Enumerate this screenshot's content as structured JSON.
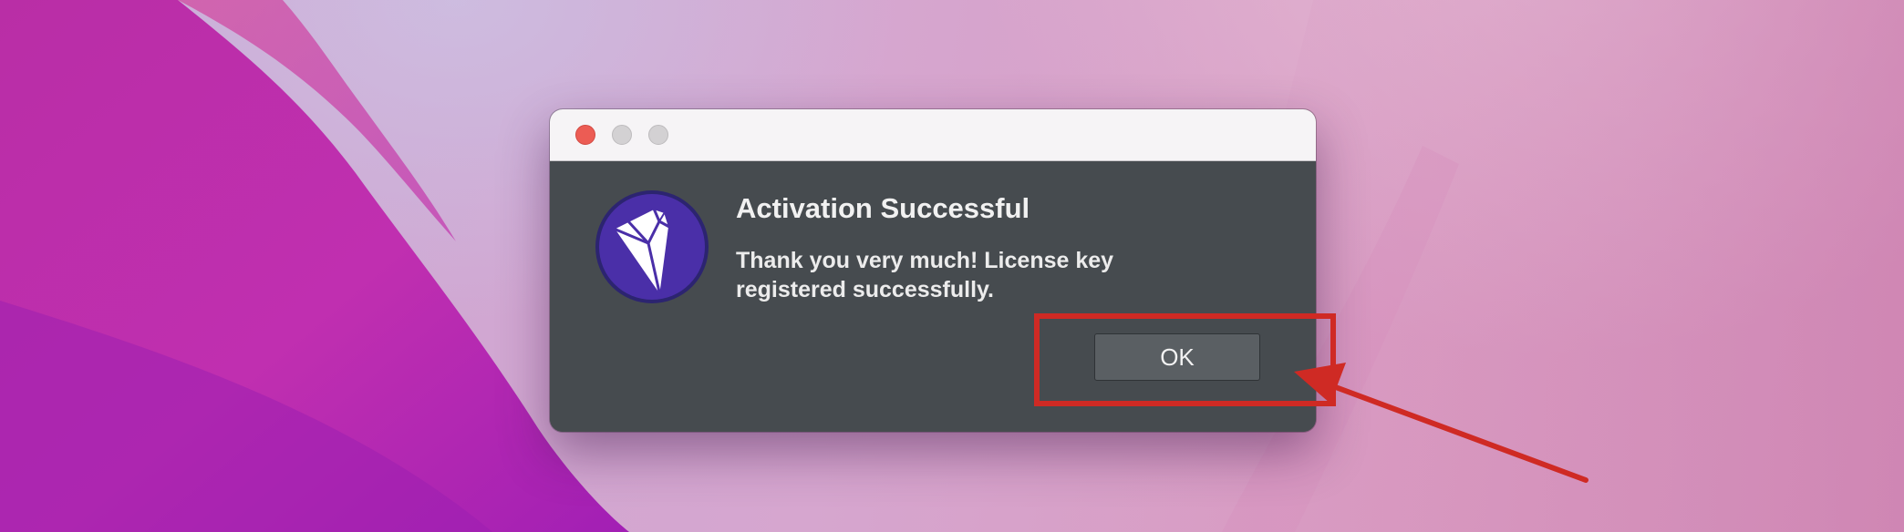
{
  "dialog": {
    "title": "Activation Successful",
    "message": "Thank you very much! License key registered successfully.",
    "ok_label": "OK",
    "app_icon": "diamond-app-icon"
  },
  "window_controls": [
    "close",
    "minimize",
    "zoom"
  ],
  "annotation": {
    "color": "#cf2a24",
    "target": "ok-button"
  },
  "colors": {
    "dialog_background": "#464b4f",
    "titlebar": "#f6f4f6",
    "close_button": "#ec5c54",
    "icon_purple": "#4a2fa8"
  }
}
